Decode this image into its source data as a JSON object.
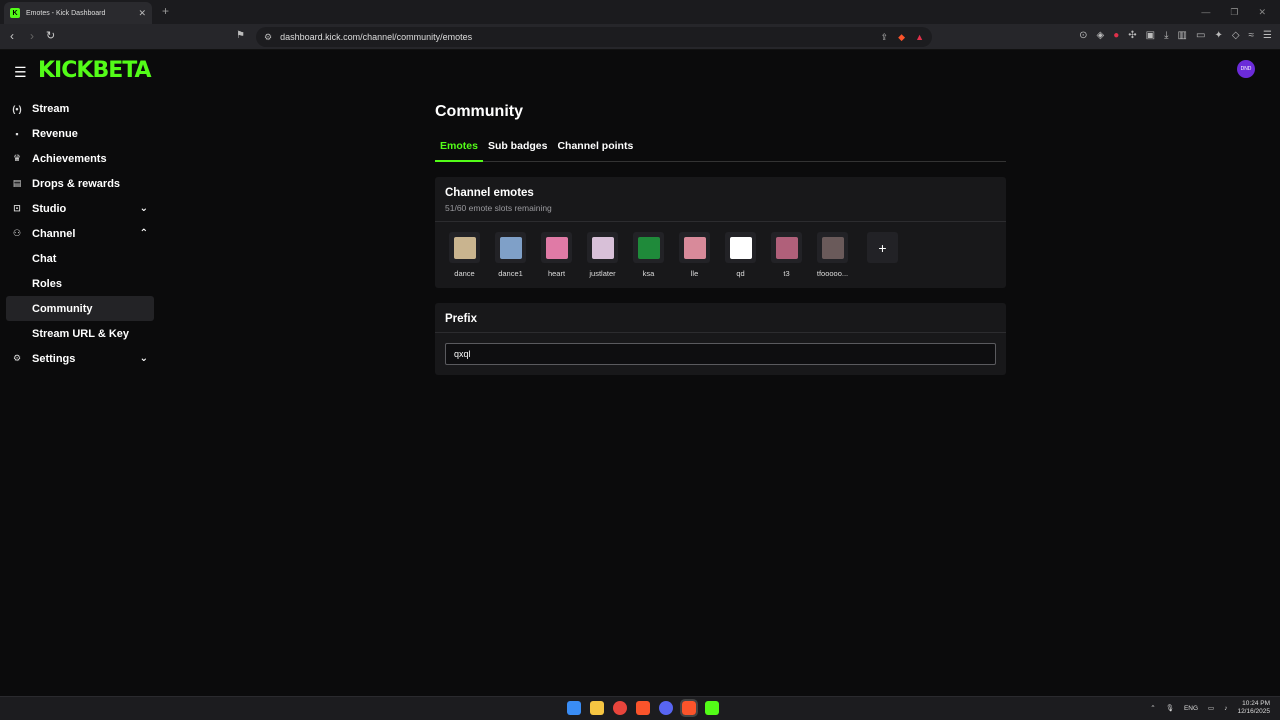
{
  "browser": {
    "tab_title": "Emotes - Kick Dashboard",
    "tab_close": "✕",
    "new_tab": "+",
    "url": "dashboard.kick.com/channel/community/emotes"
  },
  "header": {
    "logo_text": "KICK",
    "logo_badge": "BETA",
    "avatar_text": "DND"
  },
  "sidebar": {
    "items": [
      {
        "label": "Stream",
        "icon": "broadcast-icon"
      },
      {
        "label": "Revenue",
        "icon": "revenue-icon"
      },
      {
        "label": "Achievements",
        "icon": "trophy-icon"
      },
      {
        "label": "Drops & rewards",
        "icon": "gift-icon"
      },
      {
        "label": "Studio",
        "icon": "studio-icon"
      },
      {
        "label": "Channel",
        "icon": "channel-icon"
      },
      {
        "label": "Chat"
      },
      {
        "label": "Roles"
      },
      {
        "label": "Community"
      },
      {
        "label": "Stream URL & Key"
      },
      {
        "label": "Settings",
        "icon": "gear-icon"
      }
    ]
  },
  "main": {
    "title": "Community",
    "tabs": [
      "Emotes",
      "Sub badges",
      "Channel points"
    ],
    "emotes_card": {
      "title": "Channel emotes",
      "subtitle": "51/60 emote slots remaining",
      "emotes": [
        {
          "name": "dance",
          "color": "#c9b48f"
        },
        {
          "name": "dance1",
          "color": "#7fa0c8"
        },
        {
          "name": "heart",
          "color": "#e07aa6"
        },
        {
          "name": "justlater",
          "color": "#d8c0d8"
        },
        {
          "name": "ksa",
          "color": "#1f8a3a"
        },
        {
          "name": "lle",
          "color": "#d88a9a"
        },
        {
          "name": "qd",
          "color": "#ffffff"
        },
        {
          "name": "t3",
          "color": "#b0607a"
        },
        {
          "name": "tfooooo...",
          "color": "#6a5a5a"
        }
      ],
      "add_label": "+"
    },
    "prefix_card": {
      "title": "Prefix",
      "value": "qxql"
    }
  },
  "taskbar": {
    "lang": "ENG",
    "time": "10:24 PM",
    "date": "12/16/2025"
  }
}
